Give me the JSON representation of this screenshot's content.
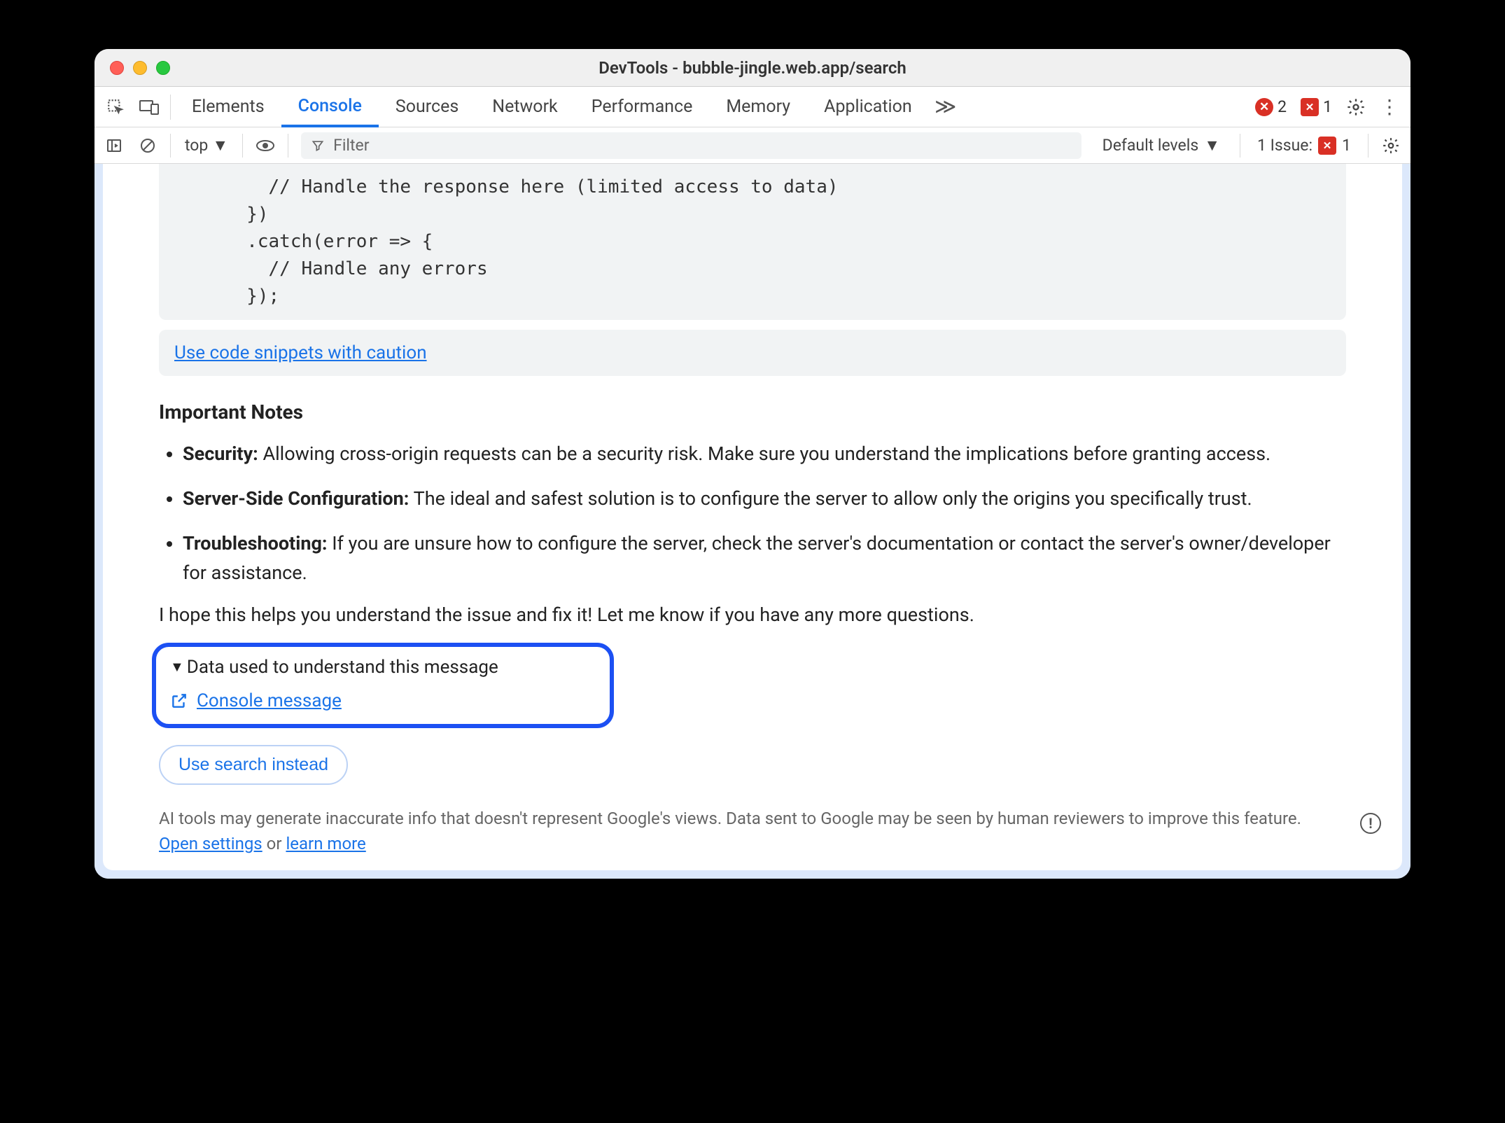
{
  "window_title": "DevTools - bubble-jingle.web.app/search",
  "tabs": {
    "elements": "Elements",
    "console": "Console",
    "sources": "Sources",
    "network": "Network",
    "performance": "Performance",
    "memory": "Memory",
    "application": "Application"
  },
  "errors_count": "2",
  "issues_count": "1",
  "subbar": {
    "context": "top",
    "filter_placeholder": "Filter",
    "levels": "Default levels",
    "issue_label": "1 Issue:",
    "issue_count": "1"
  },
  "code": "          // Handle the response here (limited access to data)\n        })\n        .catch(error => {\n          // Handle any errors\n        });",
  "snippet_link": "Use code snippets with caution",
  "notes_heading": "Important Notes",
  "notes": {
    "security_label": "Security:",
    "security_text": " Allowing cross-origin requests can be a security risk. Make sure you understand the implications before granting access.",
    "server_label": "Server-Side Configuration:",
    "server_text": " The ideal and safest solution is to configure the server to allow only the origins you specifically trust.",
    "trouble_label": "Troubleshooting:",
    "trouble_text": " If you are unsure how to configure the server, check the server's documentation or contact the server's owner/developer for assistance."
  },
  "closing": "I hope this helps you understand the issue and fix it! Let me know if you have any more questions.",
  "data_used_label": "Data used to understand this message",
  "console_message_link": "Console message",
  "search_button": "Use search instead",
  "footer_text_1": "AI tools may generate inaccurate info that doesn't represent Google's views. Data sent to Google may be seen by human reviewers to improve this feature. ",
  "footer_link_1": "Open settings",
  "footer_or": " or ",
  "footer_link_2": "learn more"
}
